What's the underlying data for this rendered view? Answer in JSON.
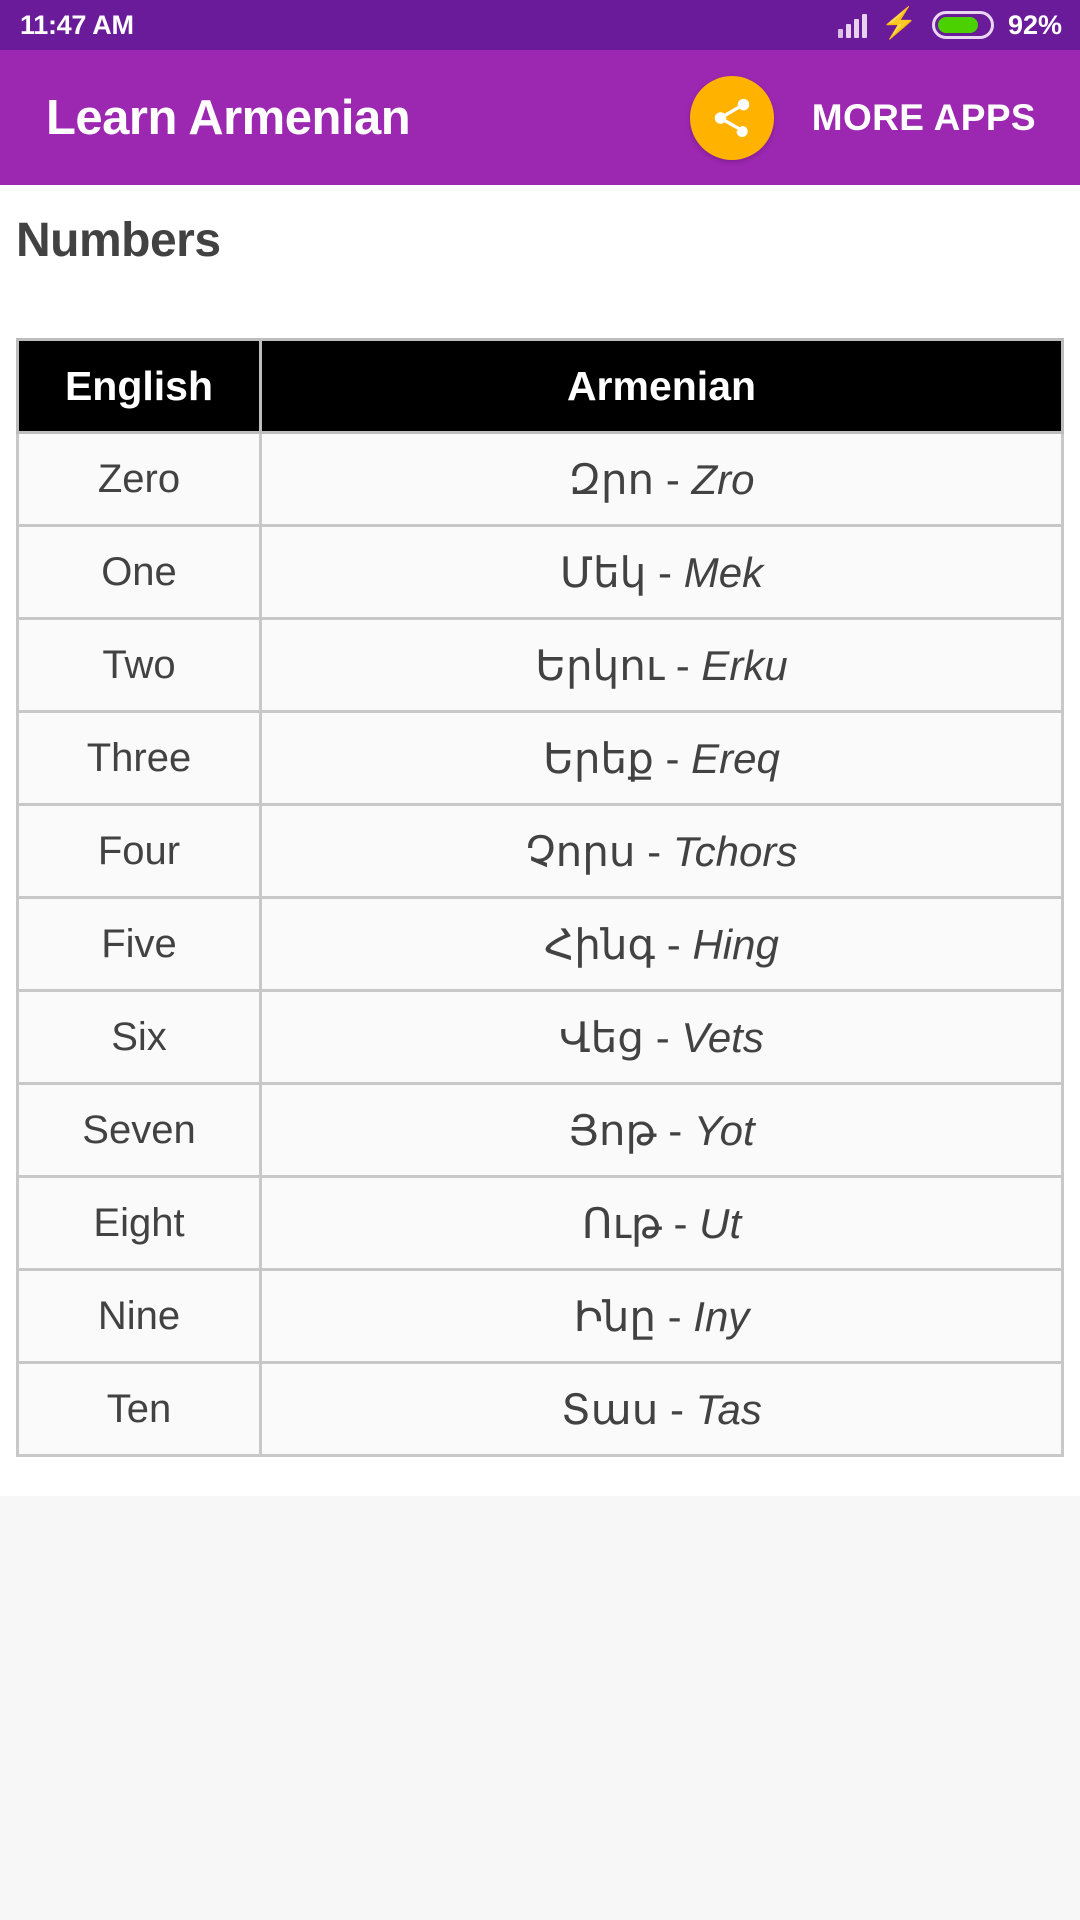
{
  "status_bar": {
    "time": "11:47 AM",
    "battery_percent": "92%",
    "icons": [
      "signal-icon",
      "charging-bolt-icon",
      "battery-icon"
    ],
    "background_color": "#6a1b9a"
  },
  "app_bar": {
    "title": "Learn Armenian",
    "share_label": "share-icon",
    "more_apps_label": "MORE APPS",
    "background_color": "#9c27b0",
    "share_button_color": "#ffb300"
  },
  "page": {
    "title": "Numbers"
  },
  "table": {
    "headers": [
      "English",
      "Armenian"
    ],
    "rows": [
      {
        "english": "Zero",
        "armenian": "Զրո",
        "translit": "Zro"
      },
      {
        "english": "One",
        "armenian": "Մեկ",
        "translit": "Mek"
      },
      {
        "english": "Two",
        "armenian": "Երկու",
        "translit": "Erku"
      },
      {
        "english": "Three",
        "armenian": "Երեք",
        "translit": "Ereq"
      },
      {
        "english": "Four",
        "armenian": "Չորս",
        "translit": "Tchors"
      },
      {
        "english": "Five",
        "armenian": "Հինգ",
        "translit": "Hing"
      },
      {
        "english": "Six",
        "armenian": "Վեց",
        "translit": "Vets"
      },
      {
        "english": "Seven",
        "armenian": "Յոթ",
        "translit": "Yot"
      },
      {
        "english": "Eight",
        "armenian": "Ութ",
        "translit": "Ut"
      },
      {
        "english": "Nine",
        "armenian": "Ինը",
        "translit": "Iny"
      },
      {
        "english": "Ten",
        "armenian": "Տաս",
        "translit": "Tas"
      }
    ],
    "separator": " - "
  }
}
